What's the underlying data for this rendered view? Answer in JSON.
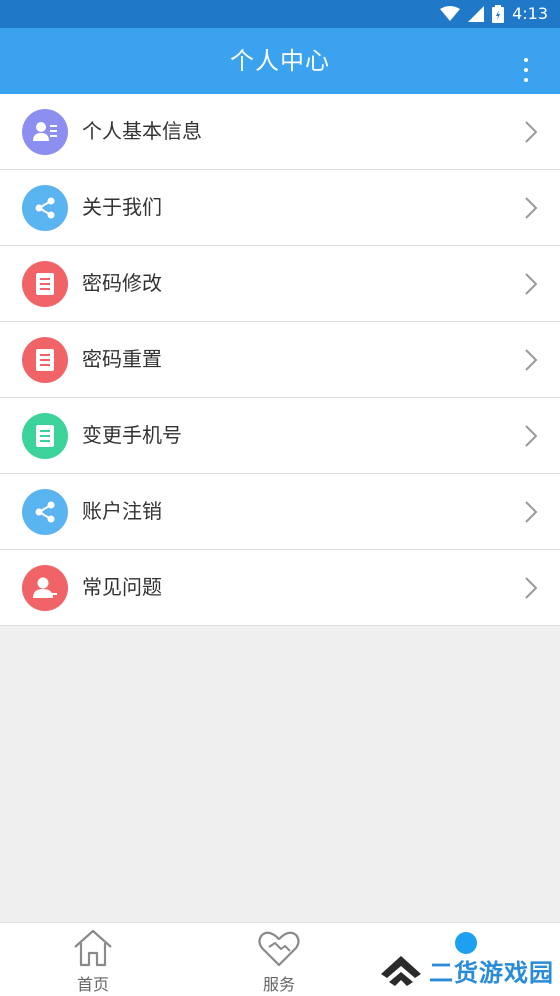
{
  "status_bar": {
    "time": "4:13"
  },
  "header": {
    "title": "个人中心"
  },
  "menu": [
    {
      "label": "个人基本信息",
      "icon": "user-card-icon",
      "color": "#8c8ef0"
    },
    {
      "label": "关于我们",
      "icon": "share-icon",
      "color": "#5ab4f0"
    },
    {
      "label": "密码修改",
      "icon": "document-icon",
      "color": "#f06467"
    },
    {
      "label": "密码重置",
      "icon": "document-icon",
      "color": "#f06467"
    },
    {
      "label": "变更手机号",
      "icon": "document-icon",
      "color": "#3cd39a"
    },
    {
      "label": "账户注销",
      "icon": "share-icon",
      "color": "#5ab4f0"
    },
    {
      "label": "常见问题",
      "icon": "user-icon",
      "color": "#f06467"
    }
  ],
  "bottom_nav": [
    {
      "label": "首页",
      "icon": "home-icon"
    },
    {
      "label": "服务",
      "icon": "handshake-heart-icon"
    },
    {
      "label": "",
      "icon": "profile-dot-icon",
      "color": "#1ea0f0"
    }
  ],
  "watermark": {
    "text": "二货游戏园",
    "color": "#2a8bd8"
  }
}
